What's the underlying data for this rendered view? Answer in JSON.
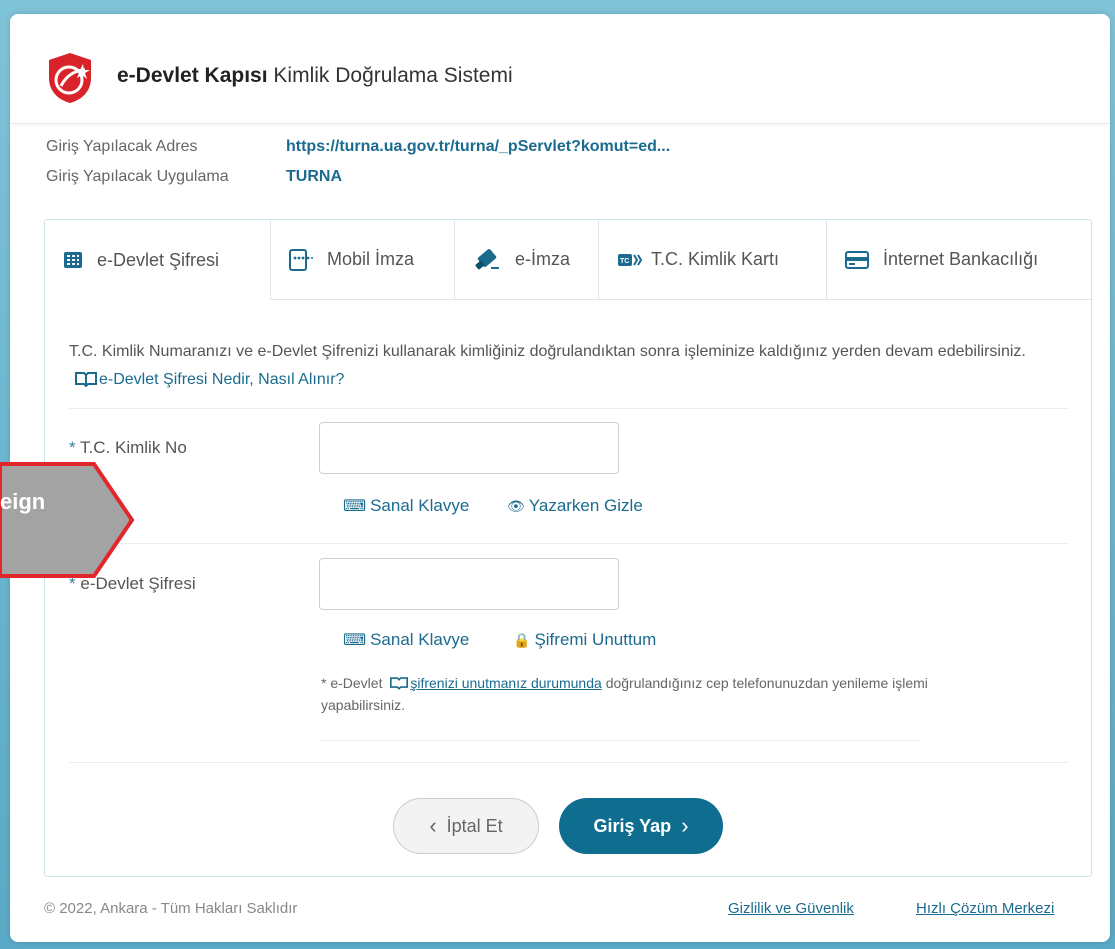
{
  "brand": {
    "bold": "e-Devlet Kapısı",
    "rest": " Kimlik Doğrulama Sistemi"
  },
  "info": {
    "address_label": "Giriş Yapılacak Adres",
    "address_value": "https://turna.ua.gov.tr/turna/_pServlet?komut=ed...",
    "app_label": "Giriş Yapılacak Uygulama",
    "app_value": "TURNA"
  },
  "tabs": [
    {
      "label": "e-Devlet Şifresi",
      "icon": "keypad-icon",
      "active": true
    },
    {
      "label": "Mobil İmza",
      "icon": "mobile-signature-icon"
    },
    {
      "label": "e-İmza",
      "icon": "usb-token-icon"
    },
    {
      "label": "T.C. Kimlik Kartı",
      "icon": "id-card-icon"
    },
    {
      "label": "İnternet Bankacılığı",
      "icon": "bank-card-icon"
    }
  ],
  "intro": {
    "text": "T.C. Kimlik Numaranızı ve e-Devlet Şifrenizi kullanarak kimliğiniz doğrulandıktan sonra işleminize kaldığınız yerden devam edebilirsiniz.",
    "link": "e-Devlet Şifresi Nedir, Nasıl Alınır?"
  },
  "form": {
    "id_label": "T.C. Kimlik No",
    "id_value": "",
    "virtual_keyboard": "Sanal Klavye",
    "hide_typing": "Yazarken Gizle",
    "password_label": "e-Devlet Şifresi",
    "password_value": "",
    "forgot": "Şifremi Unuttum",
    "note_prefix": "* e-Devlet",
    "note_link": "şifrenizi unutmanız durumunda",
    "note_suffix": "doğrulandığınız cep telefonunuzdan yenileme işlemi yapabilirsiniz."
  },
  "buttons": {
    "cancel": "İptal Et",
    "login": "Giriş Yap"
  },
  "footer": {
    "copyright": "© 2022, Ankara - Tüm Hakları Saklıdır",
    "privacy": "Gizlilik ve Güvenlik",
    "help": "Hızlı Çözüm Merkezi"
  },
  "overlay": {
    "text": "eign"
  },
  "colors": {
    "primary": "#0f6e8f",
    "link": "#1b6b8f",
    "logo_red": "#d8232a",
    "overlay_gray": "#a3a3a3"
  }
}
